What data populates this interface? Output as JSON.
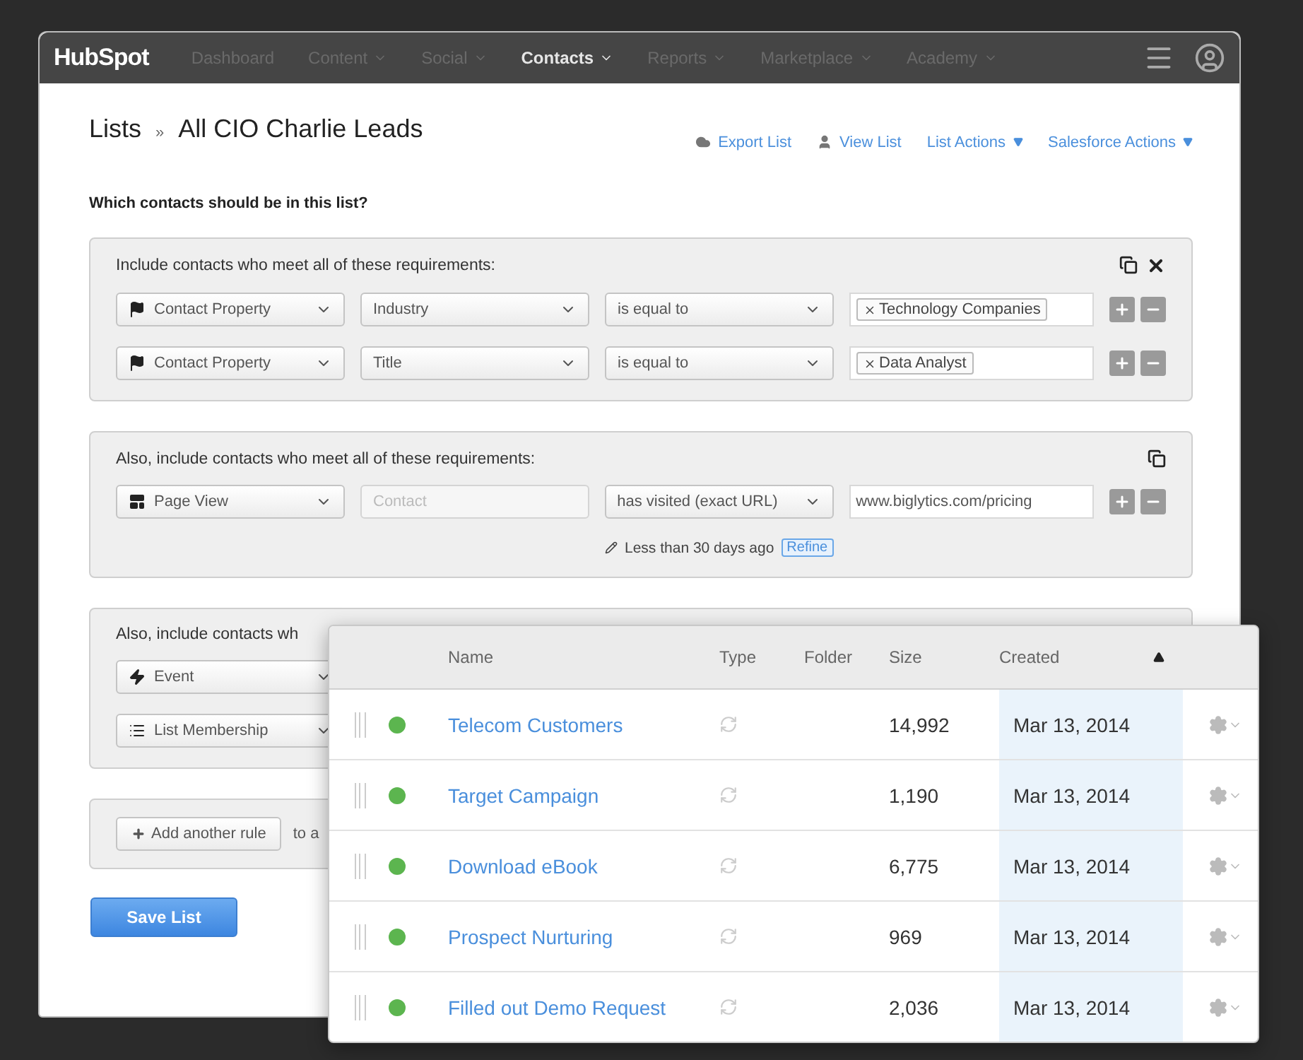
{
  "nav": {
    "logo": "HubSpot",
    "items": [
      {
        "label": "Dashboard",
        "selected": false,
        "dropdown": false
      },
      {
        "label": "Content",
        "selected": false,
        "dropdown": true
      },
      {
        "label": "Social",
        "selected": false,
        "dropdown": true
      },
      {
        "label": "Contacts",
        "selected": true,
        "dropdown": true
      },
      {
        "label": "Reports",
        "selected": false,
        "dropdown": true
      },
      {
        "label": "Marketplace",
        "selected": false,
        "dropdown": true
      },
      {
        "label": "Academy",
        "selected": false,
        "dropdown": true
      }
    ]
  },
  "header": {
    "root": "Lists",
    "separator": "»",
    "title": "All CIO Charlie Leads",
    "actions": [
      {
        "label": "Export List",
        "kind": "export",
        "dropdown": false
      },
      {
        "label": "View List",
        "kind": "view",
        "dropdown": false
      },
      {
        "label": "List Actions",
        "kind": "menu",
        "dropdown": true
      },
      {
        "label": "Salesforce Actions",
        "kind": "menu",
        "dropdown": true
      }
    ]
  },
  "question": "Which contacts should be in this list?",
  "groups": [
    {
      "heading": "Include contacts who meet all of these requirements:",
      "copyable": true,
      "removable": true,
      "rules": [
        {
          "property": {
            "kind": "contact",
            "label": "Contact Property"
          },
          "field": {
            "label": "Industry"
          },
          "operator": "is equal to",
          "value": {
            "kind": "tags",
            "tags": [
              "Technology Companies"
            ]
          }
        },
        {
          "property": {
            "kind": "contact",
            "label": "Contact Property"
          },
          "field": {
            "label": "Title"
          },
          "operator": "is equal to",
          "value": {
            "kind": "tags",
            "tags": [
              "Data Analyst"
            ]
          }
        }
      ]
    },
    {
      "heading": "Also, include contacts who meet all of these requirements:",
      "copyable": true,
      "removable": false,
      "rules": [
        {
          "property": {
            "kind": "page",
            "label": "Page View"
          },
          "field": {
            "placeholder": "Contact"
          },
          "operator": "has visited (exact URL)",
          "value": {
            "kind": "text",
            "text": "www.biglytics.com/pricing"
          },
          "note": {
            "text": "Less than 30 days ago",
            "button": "Refine"
          }
        }
      ]
    },
    {
      "heading": "Also, include contacts wh",
      "copyable": false,
      "removable": false,
      "rules": [
        {
          "property": {
            "kind": "event",
            "label": "Event"
          }
        },
        {
          "property": {
            "kind": "list",
            "label": "List Membership"
          }
        }
      ]
    }
  ],
  "add_rule": {
    "button": "Add another rule",
    "trailing": "to a"
  },
  "save_button": "Save List",
  "popup_table": {
    "columns": [
      {
        "label": "Name",
        "sorted": false
      },
      {
        "label": "Type",
        "sorted": false
      },
      {
        "label": "Folder",
        "sorted": false
      },
      {
        "label": "Size",
        "sorted": false
      },
      {
        "label": "Created",
        "sorted": true
      }
    ],
    "rows": [
      {
        "name": "Telecom Customers",
        "color": "#5cb54f",
        "size": "14,992",
        "created": "Mar 13, 2014"
      },
      {
        "name": "Target Campaign",
        "color": "#5cb54f",
        "size": "1,190",
        "created": "Mar 13, 2014"
      },
      {
        "name": "Download eBook",
        "color": "#5cb54f",
        "size": "6,775",
        "created": "Mar 13, 2014"
      },
      {
        "name": "Prospect Nurturing",
        "color": "#5cb54f",
        "size": "969",
        "created": "Mar 13, 2014"
      },
      {
        "name": "Filled out Demo Request",
        "color": "#5cb54f",
        "size": "2,036",
        "created": "Mar 13, 2014"
      }
    ]
  }
}
